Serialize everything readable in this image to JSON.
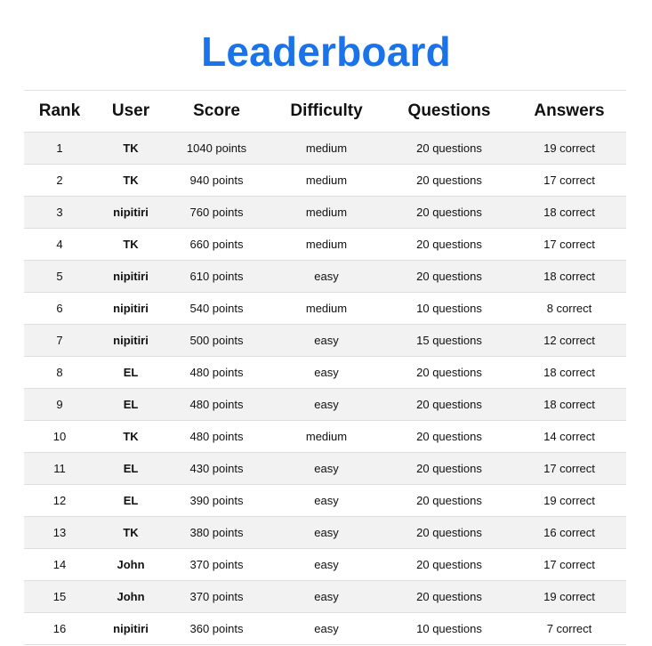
{
  "page": {
    "title": "Leaderboard",
    "accent_color": "#1a73e8"
  },
  "table": {
    "headers": [
      "Rank",
      "User",
      "Score",
      "Difficulty",
      "Questions",
      "Answers"
    ],
    "rows": [
      {
        "rank": "1",
        "user": "TK",
        "score": "1040 points",
        "difficulty": "medium",
        "questions": "20 questions",
        "answers": "19 correct"
      },
      {
        "rank": "2",
        "user": "TK",
        "score": "940 points",
        "difficulty": "medium",
        "questions": "20 questions",
        "answers": "17 correct"
      },
      {
        "rank": "3",
        "user": "nipitiri",
        "score": "760 points",
        "difficulty": "medium",
        "questions": "20 questions",
        "answers": "18 correct"
      },
      {
        "rank": "4",
        "user": "TK",
        "score": "660 points",
        "difficulty": "medium",
        "questions": "20 questions",
        "answers": "17 correct"
      },
      {
        "rank": "5",
        "user": "nipitiri",
        "score": "610 points",
        "difficulty": "easy",
        "questions": "20 questions",
        "answers": "18 correct"
      },
      {
        "rank": "6",
        "user": "nipitiri",
        "score": "540 points",
        "difficulty": "medium",
        "questions": "10 questions",
        "answers": "8 correct"
      },
      {
        "rank": "7",
        "user": "nipitiri",
        "score": "500 points",
        "difficulty": "easy",
        "questions": "15 questions",
        "answers": "12 correct"
      },
      {
        "rank": "8",
        "user": "EL",
        "score": "480 points",
        "difficulty": "easy",
        "questions": "20 questions",
        "answers": "18 correct"
      },
      {
        "rank": "9",
        "user": "EL",
        "score": "480 points",
        "difficulty": "easy",
        "questions": "20 questions",
        "answers": "18 correct"
      },
      {
        "rank": "10",
        "user": "TK",
        "score": "480 points",
        "difficulty": "medium",
        "questions": "20 questions",
        "answers": "14 correct"
      },
      {
        "rank": "11",
        "user": "EL",
        "score": "430 points",
        "difficulty": "easy",
        "questions": "20 questions",
        "answers": "17 correct"
      },
      {
        "rank": "12",
        "user": "EL",
        "score": "390 points",
        "difficulty": "easy",
        "questions": "20 questions",
        "answers": "19 correct"
      },
      {
        "rank": "13",
        "user": "TK",
        "score": "380 points",
        "difficulty": "easy",
        "questions": "20 questions",
        "answers": "16 correct"
      },
      {
        "rank": "14",
        "user": "John",
        "score": "370 points",
        "difficulty": "easy",
        "questions": "20 questions",
        "answers": "17 correct"
      },
      {
        "rank": "15",
        "user": "John",
        "score": "370 points",
        "difficulty": "easy",
        "questions": "20 questions",
        "answers": "19 correct"
      },
      {
        "rank": "16",
        "user": "nipitiri",
        "score": "360 points",
        "difficulty": "easy",
        "questions": "10 questions",
        "answers": "7 correct"
      }
    ]
  }
}
